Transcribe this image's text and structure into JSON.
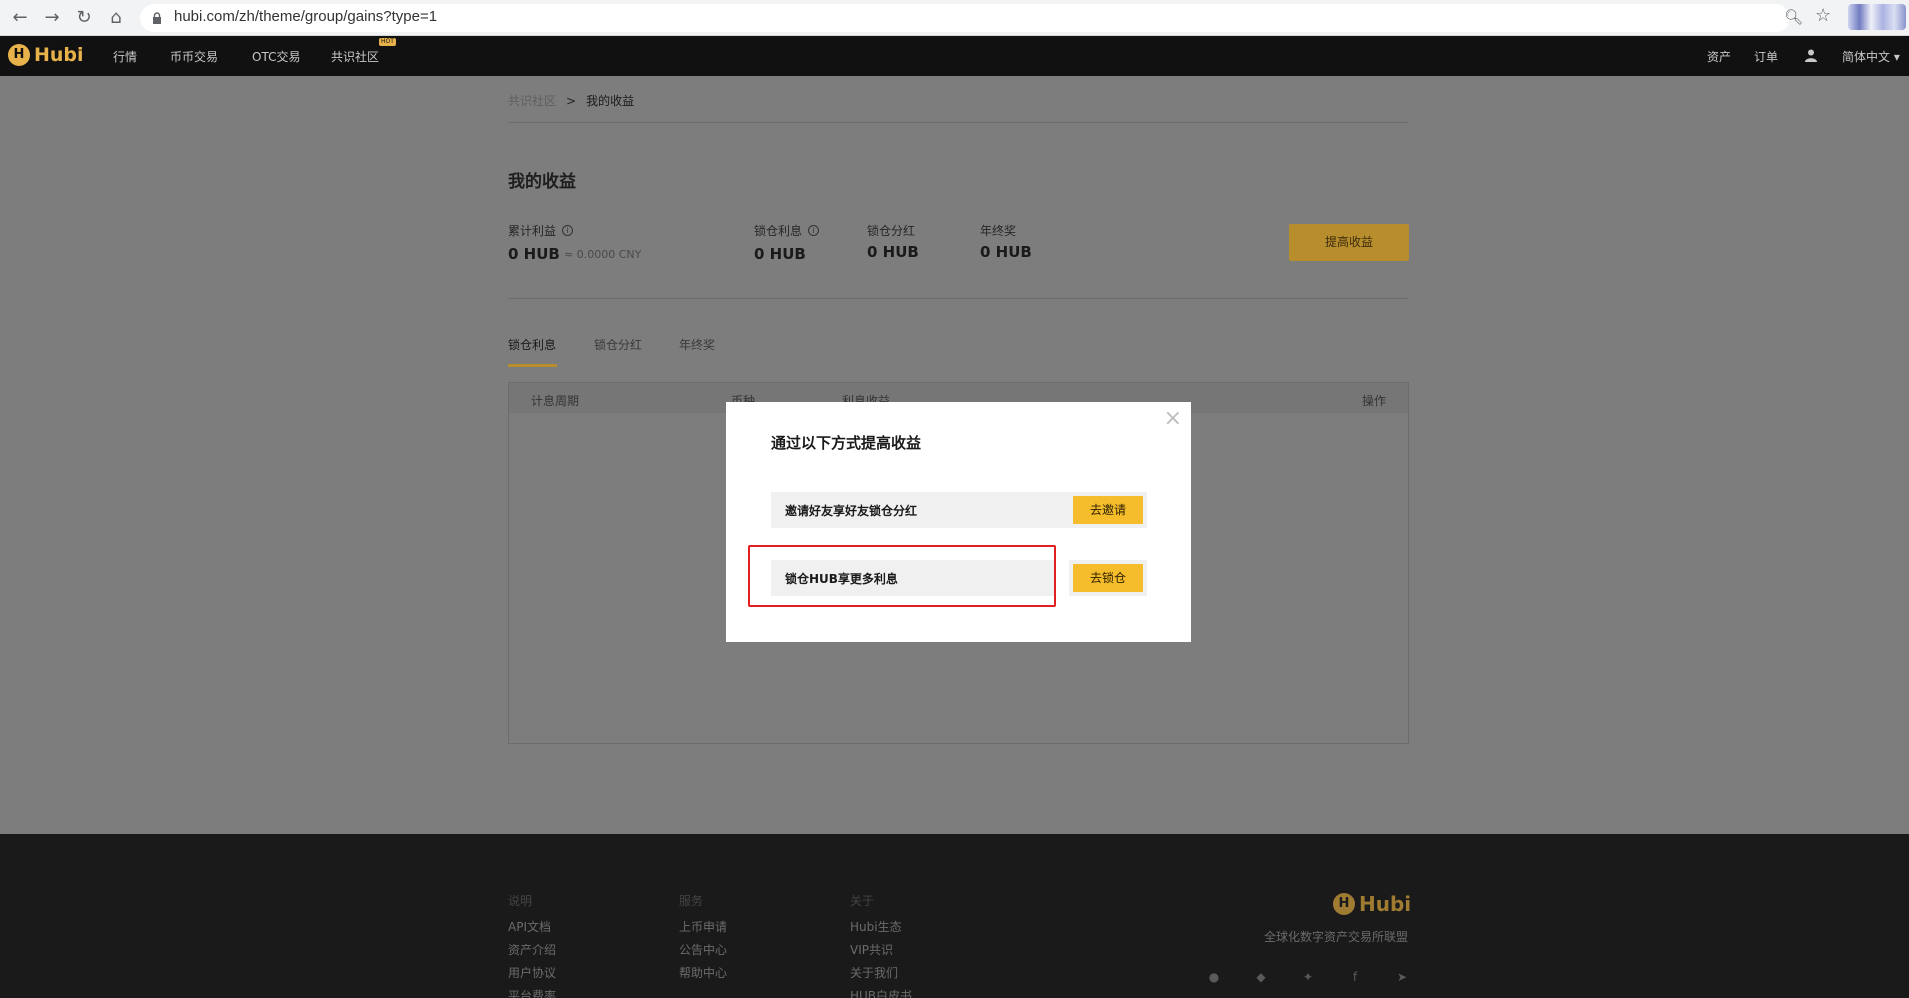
{
  "browser": {
    "url": "hubi.com/zh/theme/group/gains?type=1"
  },
  "header": {
    "logo_text": "Hubi",
    "nav": [
      "行情",
      "币币交易",
      "OTC交易",
      "共识社区"
    ],
    "hot_badge": "HOT",
    "right_nav": [
      "资产",
      "订单"
    ],
    "language": "简体中文 ▾"
  },
  "breadcrumb": {
    "parent": "共识社区",
    "separator": ">",
    "current": "我的收益"
  },
  "page": {
    "title": "我的收益",
    "stats": [
      {
        "label": "累计利益",
        "value": "0 HUB",
        "sub": "≈ 0.0000 CNY"
      },
      {
        "label": "锁仓利息",
        "value": "0 HUB"
      },
      {
        "label": "锁仓分红",
        "value": "0 HUB"
      },
      {
        "label": "年终奖",
        "value": "0 HUB"
      }
    ],
    "boost_button": "提高收益",
    "tabs": [
      "锁仓利息",
      "锁仓分红",
      "年终奖"
    ],
    "table_headers": [
      "计息周期",
      "币种",
      "利息收益",
      "操作"
    ]
  },
  "modal": {
    "title": "通过以下方式提高收益",
    "close": "×",
    "options": [
      {
        "label": "邀请好友享好友锁仓分红",
        "button": "去邀请"
      },
      {
        "label": "锁仓HUB享更多利息",
        "button": "去锁仓"
      }
    ]
  },
  "footer": {
    "columns": [
      {
        "title": "说明",
        "links": [
          "API文档",
          "资产介绍",
          "用户协议",
          "平台费率"
        ]
      },
      {
        "title": "服务",
        "links": [
          "上币申请",
          "公告中心",
          "帮助中心"
        ]
      },
      {
        "title": "关于",
        "links": [
          "Hubi生态",
          "VIP共识",
          "关于我们",
          "HUB白皮书"
        ]
      }
    ],
    "logo_text": "Hubi",
    "tagline": "全球化数字资产交易所联盟",
    "social_icons": [
      "wechat-icon",
      "qq-icon",
      "twitter-icon",
      "facebook-icon",
      "telegram-icon"
    ]
  },
  "colors": {
    "accent": "#f5bd2b",
    "highlight": "#e02020",
    "header_bg": "#111111"
  }
}
